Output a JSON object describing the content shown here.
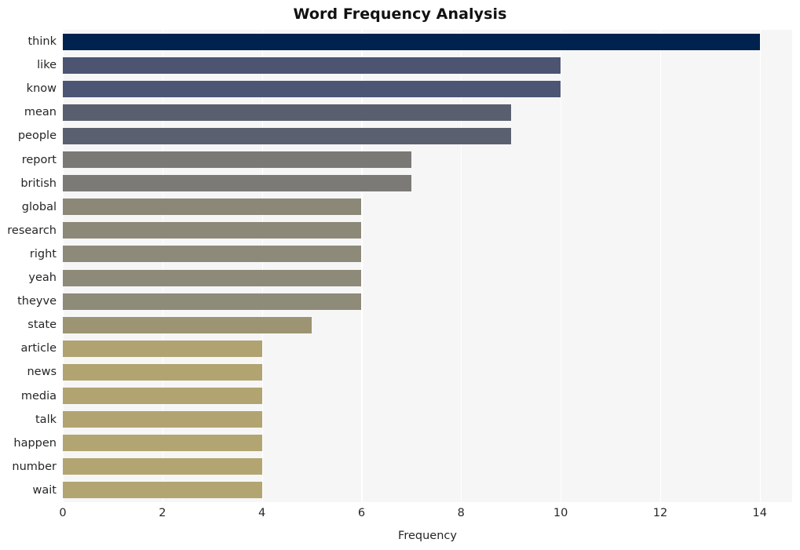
{
  "chart_data": {
    "type": "bar",
    "orientation": "horizontal",
    "title": "Word Frequency Analysis",
    "xlabel": "Frequency",
    "ylabel": "",
    "categories": [
      "think",
      "like",
      "know",
      "mean",
      "people",
      "report",
      "british",
      "global",
      "research",
      "right",
      "yeah",
      "theyve",
      "state",
      "article",
      "news",
      "media",
      "talk",
      "happen",
      "number",
      "wait"
    ],
    "values": [
      14,
      10,
      10,
      9,
      9,
      7,
      7,
      6,
      6,
      6,
      6,
      6,
      5,
      4,
      4,
      4,
      4,
      4,
      4,
      4
    ],
    "bar_colors": [
      "#00224e",
      "#4c5472",
      "#4c5573",
      "#5a5f6f",
      "#5b6070",
      "#7a7975",
      "#7b7a76",
      "#8c8878",
      "#8d8978",
      "#8e8a79",
      "#8e8a79",
      "#8f8b79",
      "#9c9472",
      "#b0a371",
      "#b1a471",
      "#b1a471",
      "#b2a471",
      "#b2a571",
      "#b3a571",
      "#b3a571"
    ],
    "xlim": [
      0,
      14.65
    ],
    "xticks": [
      0,
      2,
      4,
      6,
      8,
      10,
      12,
      14
    ],
    "xtick_labels": [
      "0",
      "2",
      "4",
      "6",
      "8",
      "10",
      "12",
      "14"
    ],
    "grid": {
      "vertical": true,
      "horizontal": false,
      "color": "#ffffff"
    },
    "legend": null,
    "plot_background": "#f6f6f7",
    "figure_background": "#ffffff"
  }
}
